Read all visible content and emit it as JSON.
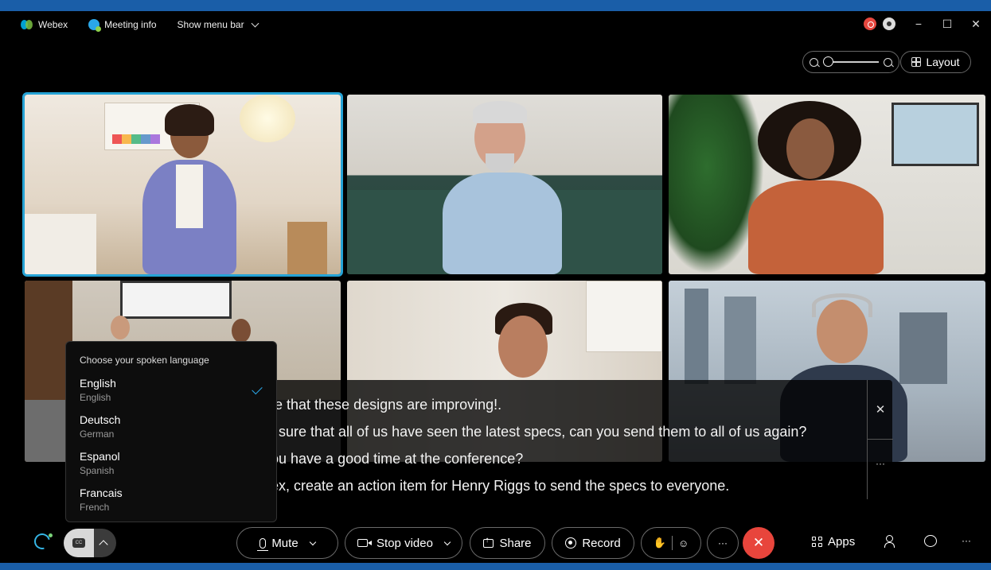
{
  "topbar": {
    "app_name": "Webex",
    "meeting_info": "Meeting info",
    "show_menu_bar": "Show menu bar",
    "minimize": "−",
    "maximize": "☐",
    "close": "✕"
  },
  "view": {
    "layout_label": "Layout"
  },
  "captions": {
    "lines": [
      "te that these designs are improving!.",
      "t sure that all of us have seen the latest specs, can you send them to all of us again?",
      "ou have a good time at the conference?",
      "ex, create an action item for Henry Riggs to send the specs to everyone."
    ],
    "close": "✕",
    "more": "···"
  },
  "language_menu": {
    "title": "Choose your spoken language",
    "options": [
      {
        "name": "English",
        "subtitle": "English",
        "selected": true
      },
      {
        "name": "Deutsch",
        "subtitle": "German",
        "selected": false
      },
      {
        "name": "Espanol",
        "subtitle": "Spanish",
        "selected": false
      },
      {
        "name": "Francais",
        "subtitle": "French",
        "selected": false
      }
    ]
  },
  "controls": {
    "cc_label": "CC",
    "mute": "Mute",
    "stop_video": "Stop video",
    "share": "Share",
    "record": "Record",
    "more": "···",
    "end": "✕",
    "apps": "Apps",
    "overflow": "···"
  },
  "colors": {
    "accent": "#25a3d6",
    "end_call": "#e8453c",
    "frame": "#1a5ea8"
  }
}
